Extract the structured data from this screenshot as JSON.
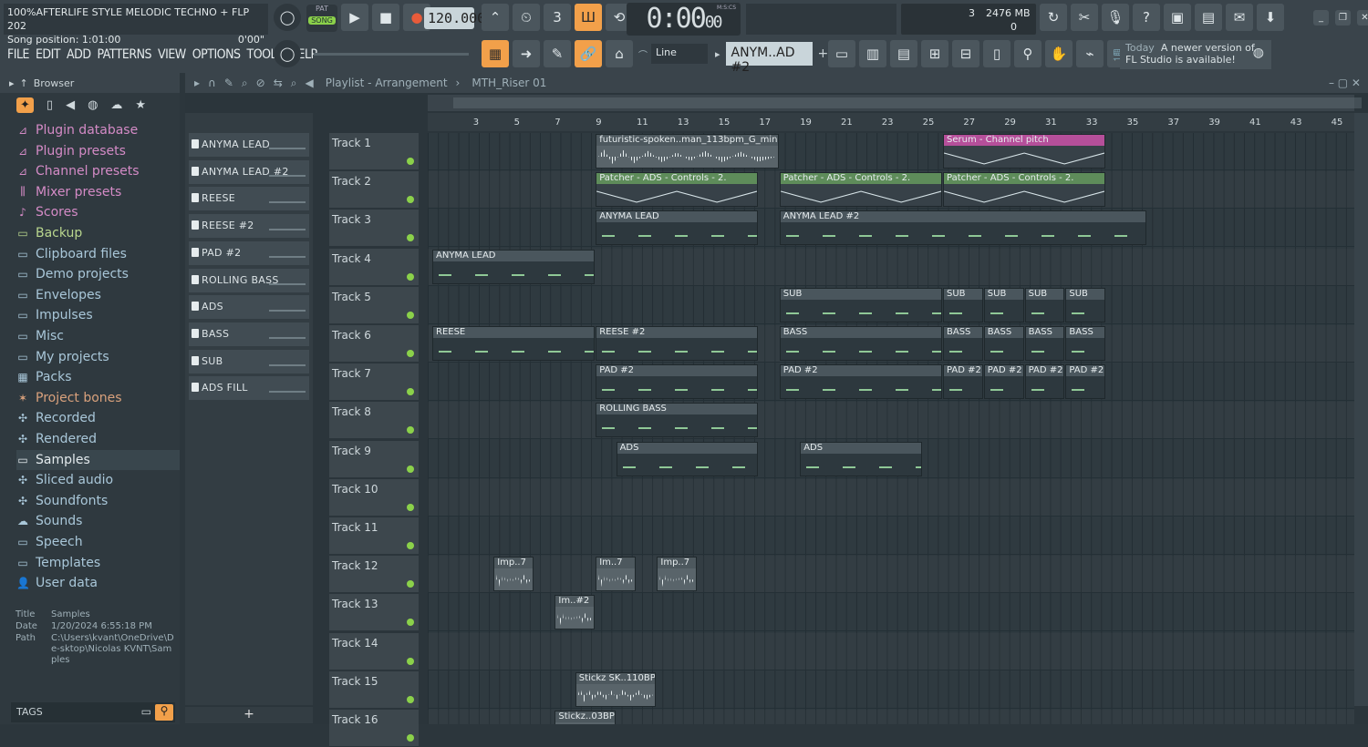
{
  "project": {
    "title": "100%AFTERLIFE STYLE MELODIC TECHNO + FLP 202",
    "song_position": "Song position: 1:01:00",
    "elapsed": "0'00\""
  },
  "transport": {
    "pat_label": "PAT",
    "song_label": "SONG",
    "tempo": "120.000",
    "time": "0:00",
    "time_sub": "00",
    "time_format": "M:S:CS"
  },
  "cpu": {
    "cpu_value": "3",
    "ram": "2476 MB",
    "poly": "0"
  },
  "menu": [
    "FILE",
    "EDIT",
    "ADD",
    "PATTERNS",
    "VIEW",
    "OPTIONS",
    "TOOLS",
    "HELP"
  ],
  "toolbar": {
    "snap": "Line",
    "pattern_name": "ANYM..AD #2"
  },
  "hint": {
    "day": "Today",
    "line1": "A newer version of",
    "line2": "FL Studio is available!"
  },
  "browser": {
    "title": "Browser",
    "items": [
      {
        "label": "Plugin database",
        "icon": "plug-icon",
        "color": "#d48bc6"
      },
      {
        "label": "Plugin presets",
        "icon": "plug-icon",
        "color": "#d48bc6"
      },
      {
        "label": "Channel presets",
        "icon": "plug-icon",
        "color": "#d48bc6"
      },
      {
        "label": "Mixer presets",
        "icon": "mixer-icon",
        "color": "#d48bc6"
      },
      {
        "label": "Scores",
        "icon": "note-icon",
        "color": "#d48bc6"
      },
      {
        "label": "Backup",
        "icon": "folder-icon",
        "color": "#b9d68e"
      },
      {
        "label": "Clipboard files",
        "icon": "folder-icon",
        "color": "#a9c7d9"
      },
      {
        "label": "Demo projects",
        "icon": "folder-icon",
        "color": "#a9c7d9"
      },
      {
        "label": "Envelopes",
        "icon": "folder-icon",
        "color": "#a9c7d9"
      },
      {
        "label": "Impulses",
        "icon": "folder-icon",
        "color": "#a9c7d9"
      },
      {
        "label": "Misc",
        "icon": "folder-icon",
        "color": "#a9c7d9"
      },
      {
        "label": "My projects",
        "icon": "folder-icon",
        "color": "#a9c7d9"
      },
      {
        "label": "Packs",
        "icon": "packs-icon",
        "color": "#a9c7d9"
      },
      {
        "label": "Project bones",
        "icon": "bones-icon",
        "color": "#d9a17c"
      },
      {
        "label": "Recorded",
        "icon": "recorded-icon",
        "color": "#a9c7d9"
      },
      {
        "label": "Rendered",
        "icon": "rendered-icon",
        "color": "#a9c7d9"
      },
      {
        "label": "Samples",
        "icon": "folder-icon",
        "color": "#e3eaed"
      },
      {
        "label": "Sliced audio",
        "icon": "sliced-icon",
        "color": "#a9c7d9"
      },
      {
        "label": "Soundfonts",
        "icon": "soundfonts-icon",
        "color": "#a9c7d9"
      },
      {
        "label": "Sounds",
        "icon": "cloud-icon",
        "color": "#a9c7d9"
      },
      {
        "label": "Speech",
        "icon": "folder-icon",
        "color": "#a9c7d9"
      },
      {
        "label": "Templates",
        "icon": "folder-icon",
        "color": "#a9c7d9"
      },
      {
        "label": "User data",
        "icon": "user-icon",
        "color": "#a9c7d9"
      }
    ],
    "info": {
      "title_k": "Title",
      "title_v": "Samples",
      "date_k": "Date",
      "date_v": "1/20/2024 6:55:18 PM",
      "path_k": "Path",
      "path_v": "C:\\Users\\kvant\\OneDrive\\De-sktop\\Nicolas KVNT\\Samples"
    },
    "tags": "TAGS"
  },
  "playlist": {
    "title": "Playlist - Arrangement",
    "crumb": "MTH_Riser 01",
    "patterns": [
      "ANYMA LEAD",
      "ANYMA LEAD #2",
      "REESE",
      "REESE #2",
      "PAD #2",
      "ROLLING BASS",
      "ADS",
      "BASS",
      "SUB",
      "ADS FILL"
    ],
    "ruler": [
      "3",
      "5",
      "7",
      "9",
      "11",
      "13",
      "15",
      "17",
      "19",
      "21",
      "23",
      "25",
      "27",
      "29",
      "31",
      "33",
      "35",
      "37",
      "39",
      "41",
      "43",
      "45"
    ],
    "tracks": [
      "Track 1",
      "Track 2",
      "Track 3",
      "Track 4",
      "Track 5",
      "Track 6",
      "Track 7",
      "Track 8",
      "Track 9",
      "Track 10",
      "Track 11",
      "Track 12",
      "Track 13",
      "Track 14",
      "Track 15",
      "Track 16"
    ],
    "clips": [
      {
        "track": 0,
        "bar": 9,
        "len": 9,
        "kind": "aud",
        "label": "futuristic-spoken..man_113bpm_G_minor"
      },
      {
        "track": 0,
        "bar": 26,
        "len": 8,
        "kind": "auto pink",
        "label": "Serum - Channel pitch"
      },
      {
        "track": 1,
        "bar": 9,
        "len": 8,
        "kind": "auto",
        "label": "Patcher - ADS - Controls - 2."
      },
      {
        "track": 1,
        "bar": 18,
        "len": 8,
        "kind": "auto",
        "label": "Patcher - ADS - Controls - 2."
      },
      {
        "track": 1,
        "bar": 26,
        "len": 8,
        "kind": "auto",
        "label": "Patcher - ADS - Controls - 2."
      },
      {
        "track": 2,
        "bar": 9,
        "len": 8,
        "kind": "pat",
        "label": "ANYMA LEAD"
      },
      {
        "track": 2,
        "bar": 18,
        "len": 18,
        "kind": "pat",
        "label": "ANYMA LEAD #2"
      },
      {
        "track": 3,
        "bar": 1,
        "len": 8,
        "kind": "pat",
        "label": "ANYMA LEAD"
      },
      {
        "track": 4,
        "bar": 18,
        "len": 8,
        "kind": "pat",
        "label": "SUB"
      },
      {
        "track": 4,
        "bar": 26,
        "len": 2,
        "kind": "pat",
        "label": "SUB"
      },
      {
        "track": 4,
        "bar": 28,
        "len": 2,
        "kind": "pat",
        "label": "SUB"
      },
      {
        "track": 4,
        "bar": 30,
        "len": 2,
        "kind": "pat",
        "label": "SUB"
      },
      {
        "track": 4,
        "bar": 32,
        "len": 2,
        "kind": "pat",
        "label": "SUB"
      },
      {
        "track": 5,
        "bar": 1,
        "len": 8,
        "kind": "pat",
        "label": "REESE"
      },
      {
        "track": 5,
        "bar": 9,
        "len": 8,
        "kind": "pat",
        "label": "REESE #2"
      },
      {
        "track": 5,
        "bar": 18,
        "len": 8,
        "kind": "pat",
        "label": "BASS"
      },
      {
        "track": 5,
        "bar": 26,
        "len": 2,
        "kind": "pat",
        "label": "BASS"
      },
      {
        "track": 5,
        "bar": 28,
        "len": 2,
        "kind": "pat",
        "label": "BASS"
      },
      {
        "track": 5,
        "bar": 30,
        "len": 2,
        "kind": "pat",
        "label": "BASS"
      },
      {
        "track": 5,
        "bar": 32,
        "len": 2,
        "kind": "pat",
        "label": "BASS"
      },
      {
        "track": 6,
        "bar": 9,
        "len": 8,
        "kind": "pat",
        "label": "PAD #2"
      },
      {
        "track": 6,
        "bar": 18,
        "len": 8,
        "kind": "pat",
        "label": "PAD #2"
      },
      {
        "track": 6,
        "bar": 26,
        "len": 2,
        "kind": "pat",
        "label": "PAD #2"
      },
      {
        "track": 6,
        "bar": 28,
        "len": 2,
        "kind": "pat",
        "label": "PAD #2"
      },
      {
        "track": 6,
        "bar": 30,
        "len": 2,
        "kind": "pat",
        "label": "PAD #2"
      },
      {
        "track": 6,
        "bar": 32,
        "len": 2,
        "kind": "pat",
        "label": "PAD #2"
      },
      {
        "track": 7,
        "bar": 9,
        "len": 8,
        "kind": "pat",
        "label": "ROLLING BASS"
      },
      {
        "track": 8,
        "bar": 10,
        "len": 7,
        "kind": "pat",
        "label": "ADS"
      },
      {
        "track": 8,
        "bar": 19,
        "len": 6,
        "kind": "pat",
        "label": "ADS"
      },
      {
        "track": 11,
        "bar": 4,
        "len": 2,
        "kind": "aud",
        "label": "Imp..7"
      },
      {
        "track": 11,
        "bar": 9,
        "len": 2,
        "kind": "aud",
        "label": "Im..7"
      },
      {
        "track": 11,
        "bar": 12,
        "len": 2,
        "kind": "aud",
        "label": "Imp..7"
      },
      {
        "track": 12,
        "bar": 7,
        "len": 2,
        "kind": "aud",
        "label": "Im..#2"
      },
      {
        "track": 14,
        "bar": 8,
        "len": 4,
        "kind": "aud",
        "label": "Stickz SK..110BPM"
      },
      {
        "track": 15,
        "bar": 7,
        "len": 3,
        "kind": "aud",
        "label": "Stickz..03BPM"
      }
    ]
  }
}
